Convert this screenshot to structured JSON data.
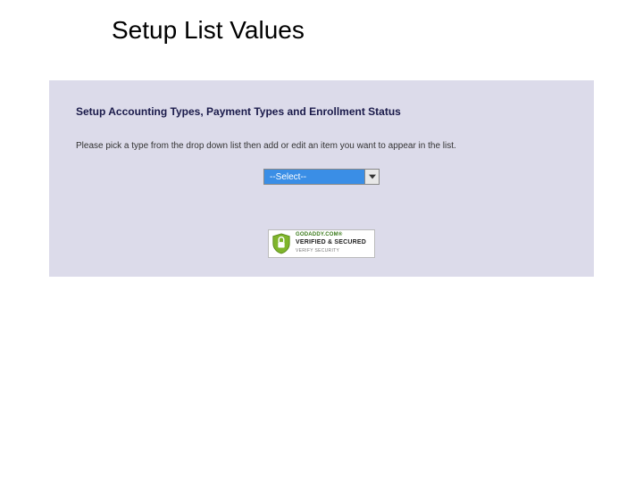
{
  "page": {
    "title": "Setup List Values"
  },
  "panel": {
    "heading": "Setup Accounting Types, Payment Types and Enrollment Status",
    "instruction": "Please pick a type from the drop down list then add or edit an item you want to appear in the list.",
    "select_placeholder": "--Select--"
  },
  "badge": {
    "top": "GODADDY.COM®",
    "main": "VERIFIED & SECURED",
    "sub": "VERIFY SECURITY"
  }
}
